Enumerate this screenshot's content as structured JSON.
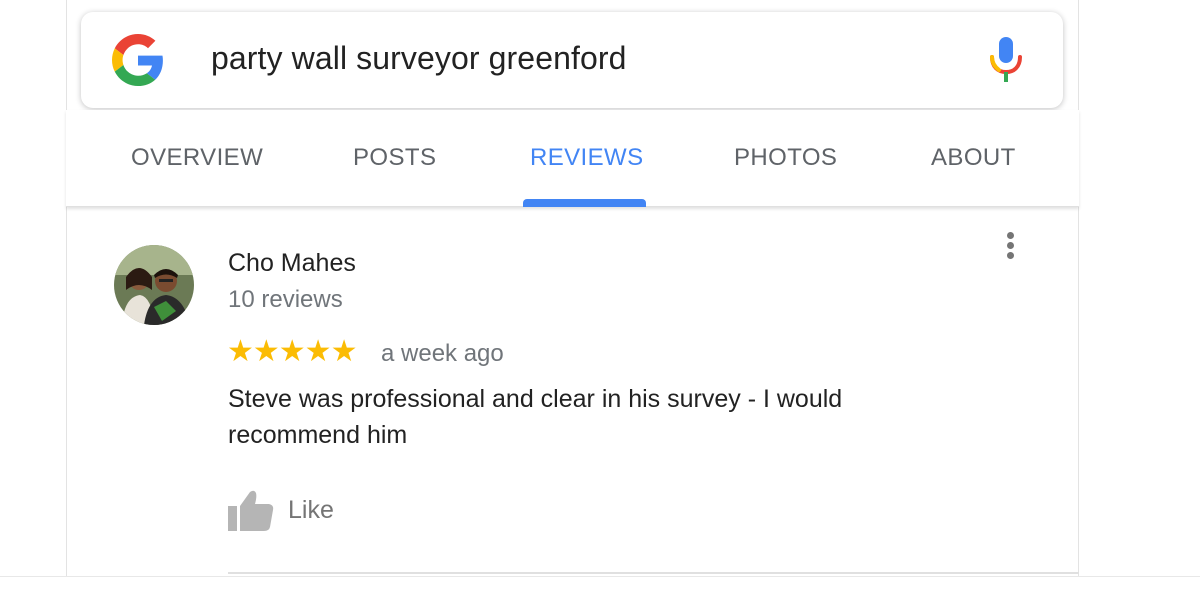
{
  "search": {
    "query": "party wall surveyor greenford",
    "logo_icon": "google-g-icon",
    "mic_icon": "microphone-icon"
  },
  "tabs": [
    {
      "label": "OVERVIEW",
      "active": false
    },
    {
      "label": "POSTS",
      "active": false
    },
    {
      "label": "REVIEWS",
      "active": true
    },
    {
      "label": "PHOTOS",
      "active": false
    },
    {
      "label": "ABOUT",
      "active": false
    }
  ],
  "review": {
    "reviewer_name": "Cho Mahes",
    "reviewer_reviews": "10 reviews",
    "rating": 5,
    "stars": "★★★★★",
    "date": "a week ago",
    "text": "Steve was professional and clear in his survey - I would recommend him",
    "like_label": "Like"
  },
  "colors": {
    "accent": "#4285f4",
    "star": "#fbbc04",
    "text_primary": "#222222",
    "text_secondary": "#70757a"
  }
}
